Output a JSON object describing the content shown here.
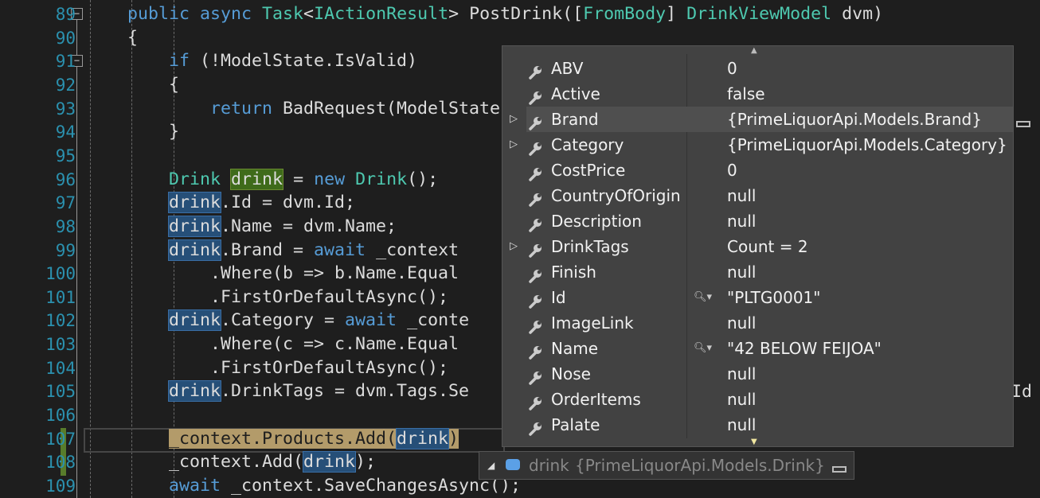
{
  "editor": {
    "lines": [
      {
        "n": "89",
        "t": [
          [
            "        ",
            ""
          ],
          [
            "public async ",
            "kw"
          ],
          [
            "Task",
            "ty"
          ],
          [
            "<",
            ""
          ],
          [
            "IActionResult",
            "ty"
          ],
          [
            "> PostDrink([",
            ""
          ],
          [
            "FromBody",
            "ty"
          ],
          [
            "] ",
            ""
          ],
          [
            "DrinkViewModel",
            "ty"
          ],
          [
            " dvm)",
            ""
          ]
        ]
      },
      {
        "n": "90",
        "t": [
          [
            "        {",
            ""
          ]
        ]
      },
      {
        "n": "91",
        "t": [
          [
            "            ",
            ""
          ],
          [
            "if",
            "kw"
          ],
          [
            " (!ModelState.IsValid)",
            ""
          ]
        ]
      },
      {
        "n": "92",
        "t": [
          [
            "            {",
            ""
          ]
        ]
      },
      {
        "n": "93",
        "t": [
          [
            "                ",
            ""
          ],
          [
            "return",
            "kw"
          ],
          [
            " BadRequest(ModelState);",
            ""
          ]
        ]
      },
      {
        "n": "94",
        "t": [
          [
            "            }",
            ""
          ]
        ]
      },
      {
        "n": "95",
        "t": []
      },
      {
        "n": "96",
        "t": [
          [
            "            ",
            ""
          ],
          [
            "Drink",
            "ty"
          ],
          [
            " ",
            ""
          ],
          [
            "drink",
            "def"
          ],
          [
            " = ",
            ""
          ],
          [
            "new",
            "kw"
          ],
          [
            " ",
            ""
          ],
          [
            "Drink",
            "ty"
          ],
          [
            "();",
            ""
          ]
        ]
      },
      {
        "n": "97",
        "t": [
          [
            "            ",
            ""
          ],
          [
            "drink",
            "ref"
          ],
          [
            ".Id = dvm.Id;",
            ""
          ]
        ]
      },
      {
        "n": "98",
        "t": [
          [
            "            ",
            ""
          ],
          [
            "drink",
            "ref"
          ],
          [
            ".Name = dvm.Name;",
            ""
          ]
        ]
      },
      {
        "n": "99",
        "t": [
          [
            "            ",
            ""
          ],
          [
            "drink",
            "ref"
          ],
          [
            ".Brand = ",
            ""
          ],
          [
            "await",
            "kw"
          ],
          [
            " _context",
            ""
          ]
        ]
      },
      {
        "n": "100",
        "t": [
          [
            "                .Where(b => b.Name.Equal",
            ""
          ]
        ]
      },
      {
        "n": "101",
        "t": [
          [
            "                .FirstOrDefaultAsync();",
            ""
          ]
        ]
      },
      {
        "n": "102",
        "t": [
          [
            "            ",
            ""
          ],
          [
            "drink",
            "ref"
          ],
          [
            ".Category = ",
            ""
          ],
          [
            "await",
            "kw"
          ],
          [
            " _conte",
            ""
          ]
        ]
      },
      {
        "n": "103",
        "t": [
          [
            "                .Where(c => c.Name.Equal",
            ""
          ]
        ]
      },
      {
        "n": "104",
        "t": [
          [
            "                .FirstOrDefaultAsync();",
            ""
          ]
        ]
      },
      {
        "n": "105",
        "t": [
          [
            "            ",
            ""
          ],
          [
            "drink",
            "ref"
          ],
          [
            ".DrinkTags = dvm.Tags.Se",
            ""
          ]
        ]
      },
      {
        "n": "106",
        "t": []
      },
      {
        "n": "107",
        "t": [
          [
            "            ",
            ""
          ],
          [
            "_context.Products.Add(",
            "cur"
          ],
          [
            "drink",
            "ref"
          ],
          [
            ")",
            "cur"
          ]
        ]
      },
      {
        "n": "108",
        "t": [
          [
            "            _context.Add(",
            ""
          ],
          [
            "drink",
            "ref"
          ],
          [
            ");",
            ""
          ]
        ]
      },
      {
        "n": "109",
        "t": [
          [
            "            ",
            ""
          ],
          [
            "await",
            "kw"
          ],
          [
            " _context.SaveChangesAsync();",
            ""
          ]
        ]
      }
    ],
    "fragment_right": "Id ="
  },
  "datatip": {
    "rows": [
      {
        "name": "ABV",
        "value": "0"
      },
      {
        "name": "Active",
        "value": "false"
      },
      {
        "name": "Brand",
        "value": "{PrimeLiquorApi.Models.Brand}",
        "expandable": true,
        "selected": true
      },
      {
        "name": "Category",
        "value": "{PrimeLiquorApi.Models.Category}",
        "expandable": true
      },
      {
        "name": "CostPrice",
        "value": "0"
      },
      {
        "name": "CountryOfOrigin",
        "value": "null"
      },
      {
        "name": "Description",
        "value": "null"
      },
      {
        "name": "DrinkTags",
        "value": "Count = 2",
        "expandable": true
      },
      {
        "name": "Finish",
        "value": "null"
      },
      {
        "name": "Id",
        "value": "\"PLTG0001\"",
        "visualizer": true
      },
      {
        "name": "ImageLink",
        "value": "null"
      },
      {
        "name": "Name",
        "value": "\"42 BELOW FEIJOA\"",
        "visualizer": true
      },
      {
        "name": "Nose",
        "value": "null"
      },
      {
        "name": "OrderItems",
        "value": "null"
      },
      {
        "name": "Palate",
        "value": "null"
      }
    ],
    "root": {
      "name": "drink",
      "value": "{PrimeLiquorApi.Models.Drink}"
    }
  },
  "colors": {
    "keyword": "#569cd6",
    "type": "#4ec9b0",
    "line_number": "#2b91af",
    "reference_highlight": "#264f78"
  }
}
